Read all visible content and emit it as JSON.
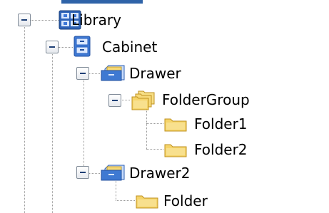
{
  "tree": {
    "library": {
      "label": "Library",
      "icon": "library-grid-icon"
    },
    "cabinet": {
      "label": "Cabinet",
      "icon": "cabinet-icon"
    },
    "drawer": {
      "label": "Drawer",
      "icon": "drawer-icon"
    },
    "folder_group": {
      "label": "FolderGroup",
      "icon": "folder-group-icon"
    },
    "folder1": {
      "label": "Folder1",
      "icon": "folder-icon"
    },
    "folder2": {
      "label": "Folder2",
      "icon": "folder-icon"
    },
    "drawer2": {
      "label": "Drawer2",
      "icon": "drawer-icon"
    },
    "folder": {
      "label": "Folder",
      "icon": "folder-icon"
    }
  },
  "colors": {
    "accent": "#2f63a8",
    "connector": "#9a9a9a",
    "folder_yellow": "#f4d36a"
  }
}
